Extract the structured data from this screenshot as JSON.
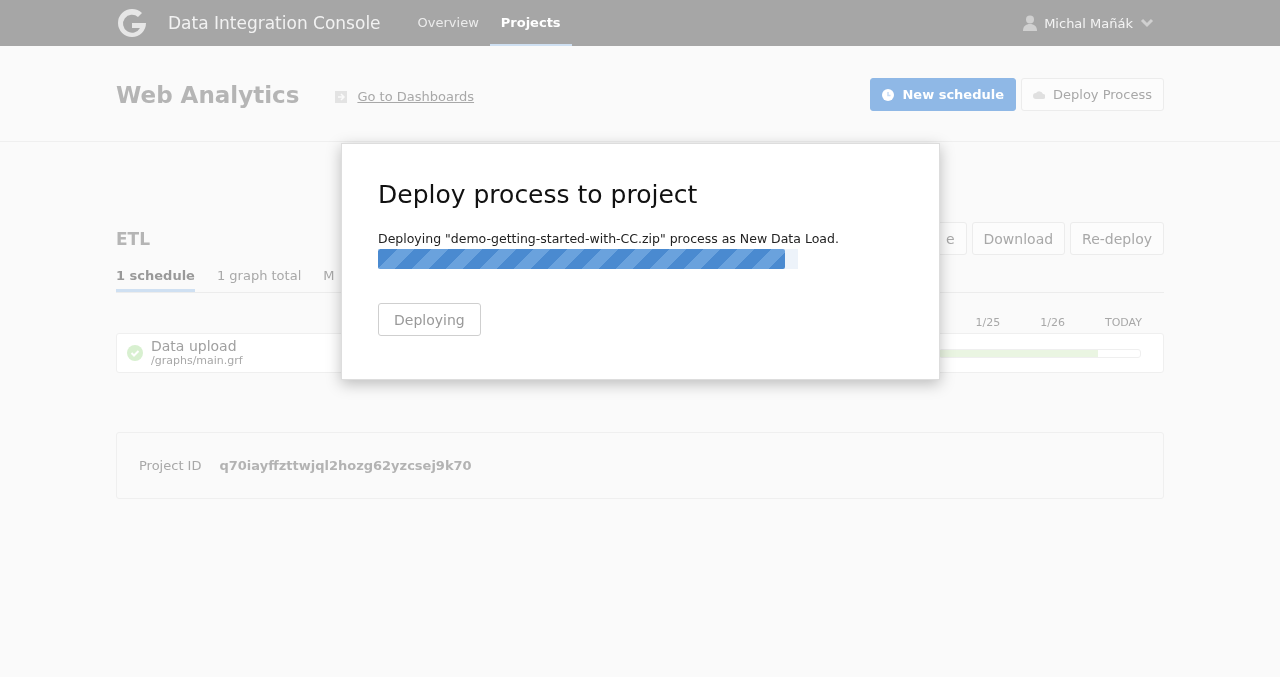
{
  "header": {
    "app_title": "Data Integration Console",
    "nav": [
      {
        "label": "Overview",
        "selected": false
      },
      {
        "label": "Projects",
        "selected": true
      }
    ],
    "user": "Michal Mañák"
  },
  "project": {
    "title": "Web Analytics",
    "link": "Go to Dashboards",
    "buttons": [
      {
        "label": "New schedule",
        "kind": "primary"
      },
      {
        "label": "Deploy Process",
        "kind": "secondary"
      }
    ]
  },
  "process": {
    "title": "ETL",
    "buttons": [
      "e",
      "Download",
      "Re-deploy"
    ],
    "tabs": [
      {
        "label": "1 schedule",
        "selected": true
      },
      {
        "label": "1 graph total",
        "selected": false
      },
      {
        "label": "M",
        "selected": false
      }
    ],
    "timeline_labels": [
      "1/25",
      "1/26",
      "TODAY"
    ],
    "schedules": [
      {
        "name": "Data upload",
        "path": "/graphs/main.grf",
        "ok": true,
        "level": 0.79
      }
    ]
  },
  "project_id": {
    "label": "Project ID",
    "value": "q70iayffzttwjql2hozg62yzcsej9k70"
  },
  "dialog": {
    "title": "Deploy process to project",
    "message": "Deploying \"demo-getting-started-with-CC.zip\" process as New Data Load.",
    "level": 0.97,
    "button": {
      "label": "Deploying",
      "disabled": true
    }
  }
}
